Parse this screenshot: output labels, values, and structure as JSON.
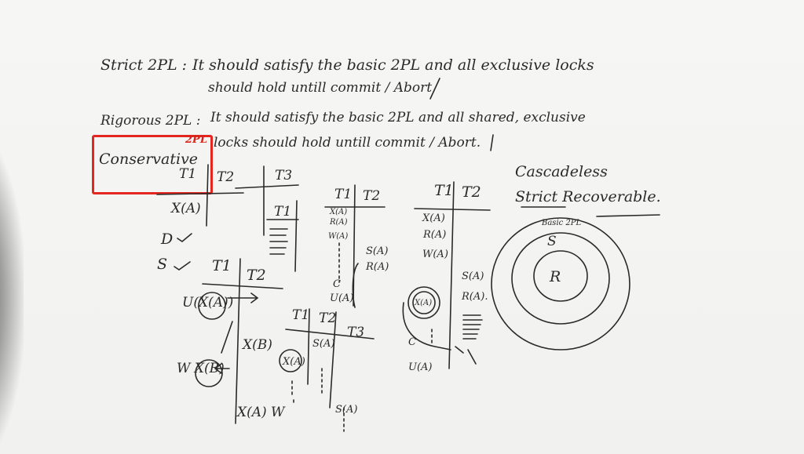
{
  "notes": {
    "strict_label": "Strict 2PL :",
    "strict_line1": "It should satisfy the basic 2PL and all exclusive locks",
    "strict_line2": "should hold untill commit / Abort",
    "rigorous_label": "Rigorous 2PL :",
    "rigorous_line1": "It should satisfy the basic 2PL and all shared, exclusive",
    "rigorous_line2": "locks should hold untill commit / Abort."
  },
  "annotation": {
    "label": "Conservative",
    "superscript": "2PL",
    "highlight_color": "#e3261f"
  },
  "schedule1": {
    "t1": "T1",
    "t2": "T2",
    "t3": "T3",
    "op1": "X(A)",
    "t1b": "T1",
    "check_d": "D",
    "check_s": "S"
  },
  "schedule2": {
    "t1": "T1",
    "t2": "T2",
    "op1": "X(A)",
    "op2": "U(X(A))",
    "op3": "X(B)",
    "op4": "W X(B)",
    "op5": "X(A) W",
    "op6": "X(A)"
  },
  "schedule3": {
    "t1": "T1",
    "t2": "T2",
    "t3": "T3",
    "op1": "S(A)",
    "op2": "S(A)"
  },
  "schedule4": {
    "t1": "T1",
    "t2": "T2",
    "op1": "X(A)",
    "op2": "R(A)",
    "op3": "W(A)",
    "op4": "S(A)",
    "op5": "R(A)",
    "op6": "C",
    "op7": "U(A)"
  },
  "schedule5": {
    "t1": "T1",
    "t2": "T2",
    "op1": "X(A)",
    "op2": "R(A)",
    "op3": "W(A)",
    "op4": "X(A)",
    "op5": "S(A)",
    "op6": "R(A).",
    "op7": "C",
    "op8": "U(A)"
  },
  "classes": {
    "line1": "Cascadeless",
    "line2": "Strict Recoverable.",
    "outer": "Basic 2PL",
    "middle": "S",
    "inner": "R"
  },
  "colors": {
    "ink": "#2a2a2a",
    "board": "#f3f3f1",
    "highlight": "#e3261f"
  }
}
